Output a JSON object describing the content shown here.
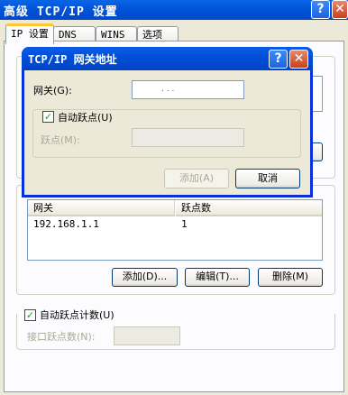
{
  "window": {
    "title": "高级 TCP/IP 设置",
    "help_glyph": "?",
    "close_glyph": "✕"
  },
  "tabs": [
    {
      "label": "IP 设置",
      "active": true
    },
    {
      "label": "DNS",
      "active": false
    },
    {
      "label": "WINS",
      "active": false
    },
    {
      "label": "选项",
      "active": false
    }
  ],
  "gateways": {
    "columns": [
      "网关",
      "跃点数"
    ],
    "rows": [
      {
        "gateway": "192.168.1.1",
        "metric": "1"
      }
    ],
    "add_label": "添加(D)...",
    "edit_label": "编辑(T)...",
    "delete_label": "删除(M)"
  },
  "auto_metric": {
    "label": "自动跃点计数(U)",
    "checked": true,
    "checkmark": "✓",
    "interface_metric_label": "接口跃点数(N):",
    "interface_metric_value": ""
  },
  "dialog": {
    "title": "TCP/IP 网关地址",
    "help_glyph": "?",
    "close_glyph": "✕",
    "gateway_label": "网关(G):",
    "gateway_value": ".       .       .",
    "auto_metric_label": "自动跃点(U)",
    "auto_metric_checked": true,
    "checkmark": "✓",
    "metric_label": "跃点(M):",
    "metric_value": "",
    "add_label": "添加(A)",
    "cancel_label": "取消"
  },
  "colors": {
    "titlebar": "#0054D8",
    "dialog_face": "#ECE9D8",
    "tab_highlight": "#FFC83C"
  }
}
